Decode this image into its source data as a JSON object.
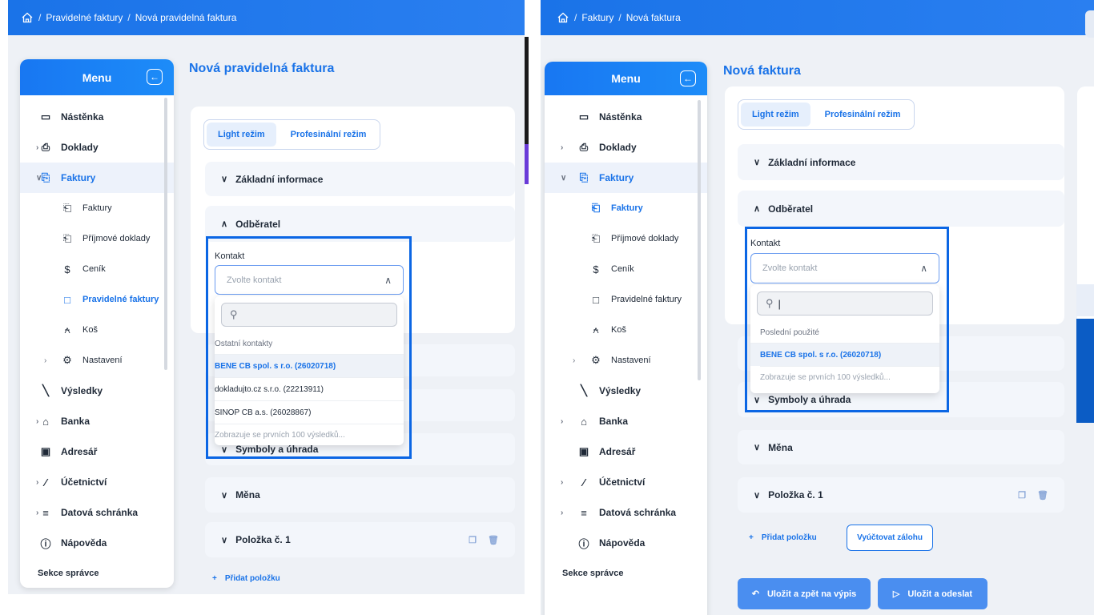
{
  "left": {
    "breadcrumb": [
      "Pravidelné faktury",
      "Nová pravidelná faktura"
    ],
    "page_title": "Nová pravidelná faktura",
    "menu_title": "Menu",
    "menu": [
      {
        "label": "Nástěnka",
        "icon": "dashboard-icon",
        "kind": "top"
      },
      {
        "label": "Doklady",
        "icon": "receipt-icon",
        "kind": "top",
        "chevron": true
      },
      {
        "label": "Faktury",
        "icon": "invoice-icon",
        "kind": "group-open"
      },
      {
        "label": "Faktury",
        "icon": "document-icon",
        "kind": "sub"
      },
      {
        "label": "Příjmové doklady",
        "icon": "document-icon",
        "kind": "sub"
      },
      {
        "label": "Ceník",
        "icon": "dollar-icon",
        "kind": "sub"
      },
      {
        "label": "Pravidelné faktury",
        "icon": "calendar-icon",
        "kind": "sub-active"
      },
      {
        "label": "Koš",
        "icon": "trash-icon",
        "kind": "sub"
      },
      {
        "label": "Nastavení",
        "icon": "gear-icon",
        "kind": "sub",
        "chevron": true
      },
      {
        "label": "Výsledky",
        "icon": "chart-icon",
        "kind": "top"
      },
      {
        "label": "Banka",
        "icon": "bank-icon",
        "kind": "top",
        "chevron": true
      },
      {
        "label": "Adresář",
        "icon": "contacts-icon",
        "kind": "top"
      },
      {
        "label": "Účetnictví",
        "icon": "pen-icon",
        "kind": "top",
        "chevron": true
      },
      {
        "label": "Datová schránka",
        "icon": "list-icon",
        "kind": "top",
        "chevron": true
      },
      {
        "label": "Nápověda",
        "icon": "info-icon",
        "kind": "top"
      }
    ],
    "admin_section": "Sekce správce",
    "modes": {
      "light": "Light režim",
      "pro": "Profesinální režim"
    },
    "sections": {
      "basic": "Základní informace",
      "customer": "Odběratel",
      "symbols": "Symboly a úhrada",
      "currency": "Měna",
      "item": "Položka č. 1"
    },
    "contact_label": "Kontakt",
    "contact_placeholder": "Zvolte kontakt",
    "dropdown_group": "Ostatní kontakty",
    "dropdown_items": [
      "BENE CB spol. s r.o. (26020718)",
      "dokladujto.cz s.r.o. (22213911)",
      "SINOP CB a.s. (26028867)"
    ],
    "dropdown_note": "Zobrazuje se prvních 100 výsledků...",
    "add_item": "Přidat položku"
  },
  "right": {
    "breadcrumb": [
      "Faktury",
      "Nová faktura"
    ],
    "page_title": "Nová faktura",
    "menu_title": "Menu",
    "menu": [
      {
        "label": "Nástěnka",
        "icon": "dashboard-icon",
        "kind": "top"
      },
      {
        "label": "Doklady",
        "icon": "receipt-icon",
        "kind": "top",
        "chevron": true
      },
      {
        "label": "Faktury",
        "icon": "invoice-icon",
        "kind": "group-open"
      },
      {
        "label": "Faktury",
        "icon": "document-icon",
        "kind": "sub-active"
      },
      {
        "label": "Příjmové doklady",
        "icon": "document-icon",
        "kind": "sub"
      },
      {
        "label": "Ceník",
        "icon": "dollar-icon",
        "kind": "sub"
      },
      {
        "label": "Pravidelné faktury",
        "icon": "calendar-icon",
        "kind": "sub"
      },
      {
        "label": "Koš",
        "icon": "trash-icon",
        "kind": "sub"
      },
      {
        "label": "Nastavení",
        "icon": "gear-icon",
        "kind": "sub",
        "chevron": true
      },
      {
        "label": "Výsledky",
        "icon": "chart-icon",
        "kind": "top"
      },
      {
        "label": "Banka",
        "icon": "bank-icon",
        "kind": "top",
        "chevron": true
      },
      {
        "label": "Adresář",
        "icon": "contacts-icon",
        "kind": "top"
      },
      {
        "label": "Účetnictví",
        "icon": "pen-icon",
        "kind": "top",
        "chevron": true
      },
      {
        "label": "Datová schránka",
        "icon": "list-icon",
        "kind": "top",
        "chevron": true
      },
      {
        "label": "Nápověda",
        "icon": "info-icon",
        "kind": "top"
      }
    ],
    "admin_section": "Sekce správce",
    "modes": {
      "light": "Light režim",
      "pro": "Profesinální režim"
    },
    "sections": {
      "basic": "Základní informace",
      "customer": "Odběratel",
      "symbols": "Symboly a úhrada",
      "currency": "Měna",
      "item": "Položka č. 1"
    },
    "contact_label": "Kontakt",
    "contact_placeholder": "Zvolte kontakt",
    "dropdown_group": "Poslední použité",
    "dropdown_items": [
      "BENE CB spol. s r.o. (26020718)"
    ],
    "dropdown_note": "Zobrazuje se prvních 100 výsledků...",
    "add_item": "Přidat položku",
    "advance_button": "Vyúčtovat zálohu",
    "save_back": "Uložit a zpět na výpis",
    "save_send": "Uložit a odeslat"
  },
  "colors": {
    "accent": "#1a73e8",
    "highlight": "#0b66e4",
    "panel": "#f3f6fb"
  }
}
